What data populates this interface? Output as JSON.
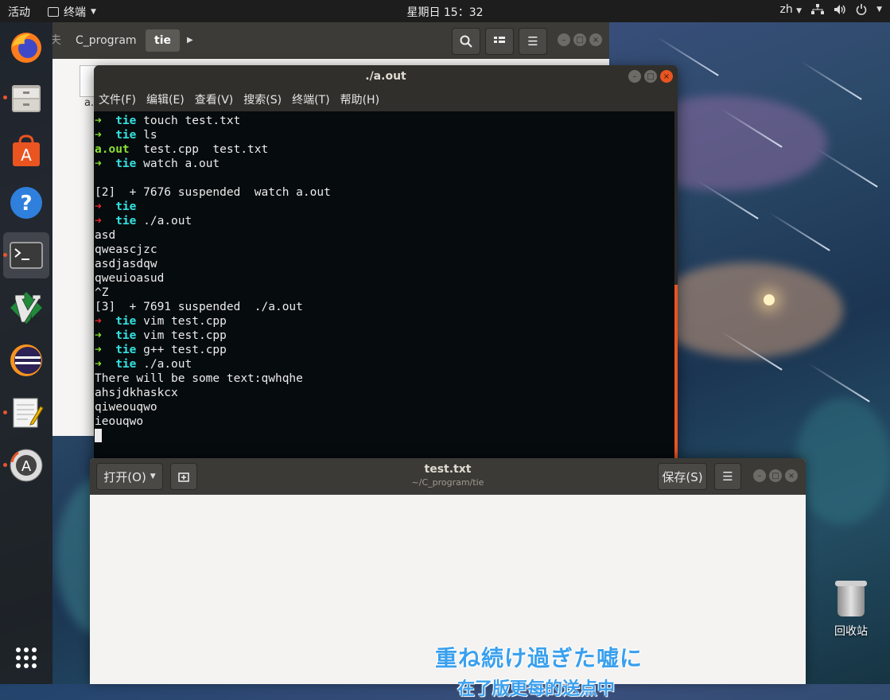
{
  "topbar": {
    "activities": "活动",
    "app_menu": "终端",
    "clock": "星期日 15：32",
    "lang": "zh"
  },
  "dock": {
    "items": [
      {
        "name": "firefox",
        "running": false
      },
      {
        "name": "files",
        "running": true
      },
      {
        "name": "software-center",
        "running": false
      },
      {
        "name": "help",
        "running": false
      },
      {
        "name": "terminal",
        "running": true
      },
      {
        "name": "vim",
        "running": false
      },
      {
        "name": "eclipse",
        "running": false
      },
      {
        "name": "text-editor",
        "running": true
      },
      {
        "name": "software-updater",
        "running": true
      }
    ],
    "show_apps": "show-applications"
  },
  "files_window": {
    "path_partial": "夫",
    "tabs": [
      "C_program",
      "tie"
    ],
    "file_label_partial": "a.o"
  },
  "terminal": {
    "title": "./a.out",
    "menu": [
      "文件(F)",
      "编辑(E)",
      "查看(V)",
      "搜索(S)",
      "终端(T)",
      "帮助(H)"
    ],
    "lines": [
      {
        "type": "prompt",
        "ok": true,
        "dir": "tie",
        "cmd": " touch test.txt"
      },
      {
        "type": "prompt",
        "ok": true,
        "dir": "tie",
        "cmd": " ls"
      },
      {
        "type": "ls",
        "exe": "a.out",
        "rest": "  test.cpp  test.txt"
      },
      {
        "type": "prompt",
        "ok": true,
        "dir": "tie",
        "cmd": " watch a.out"
      },
      {
        "type": "text",
        "text": ""
      },
      {
        "type": "text",
        "text": "[2]  + 7676 suspended  watch a.out"
      },
      {
        "type": "prompt",
        "ok": false,
        "dir": "tie",
        "cmd": ""
      },
      {
        "type": "prompt",
        "ok": false,
        "dir": "tie",
        "cmd": " ./a.out"
      },
      {
        "type": "text",
        "text": "asd"
      },
      {
        "type": "text",
        "text": "qweascjzc"
      },
      {
        "type": "text",
        "text": "asdjasdqw"
      },
      {
        "type": "text",
        "text": "qweuioasud"
      },
      {
        "type": "text",
        "text": "^Z"
      },
      {
        "type": "text",
        "text": "[3]  + 7691 suspended  ./a.out"
      },
      {
        "type": "prompt",
        "ok": false,
        "dir": "tie",
        "cmd": " vim test.cpp"
      },
      {
        "type": "prompt",
        "ok": true,
        "dir": "tie",
        "cmd": " vim test.cpp"
      },
      {
        "type": "prompt",
        "ok": true,
        "dir": "tie",
        "cmd": " g++ test.cpp"
      },
      {
        "type": "prompt",
        "ok": true,
        "dir": "tie",
        "cmd": " ./a.out"
      },
      {
        "type": "text",
        "text": "There will be some text:qwhqhe"
      },
      {
        "type": "text",
        "text": "ahsjdkhaskcx"
      },
      {
        "type": "text",
        "text": "qiweouqwo"
      },
      {
        "type": "text",
        "text": "ieouqwo"
      },
      {
        "type": "cursor"
      }
    ]
  },
  "gedit": {
    "open_label": "打开(O)",
    "title": "test.txt",
    "subtitle": "~/C_program/tie",
    "save_label": "保存(S)"
  },
  "subtitle": {
    "line1": "重ね続け過ぎた嘘に",
    "line2": "在了版更每的送点中"
  },
  "desktop": {
    "trash_label": "回收站"
  },
  "colors": {
    "accent": "#e95420",
    "prompt_ok": "#8ae234",
    "prompt_err": "#ef2929",
    "dir": "#34e2e2"
  }
}
